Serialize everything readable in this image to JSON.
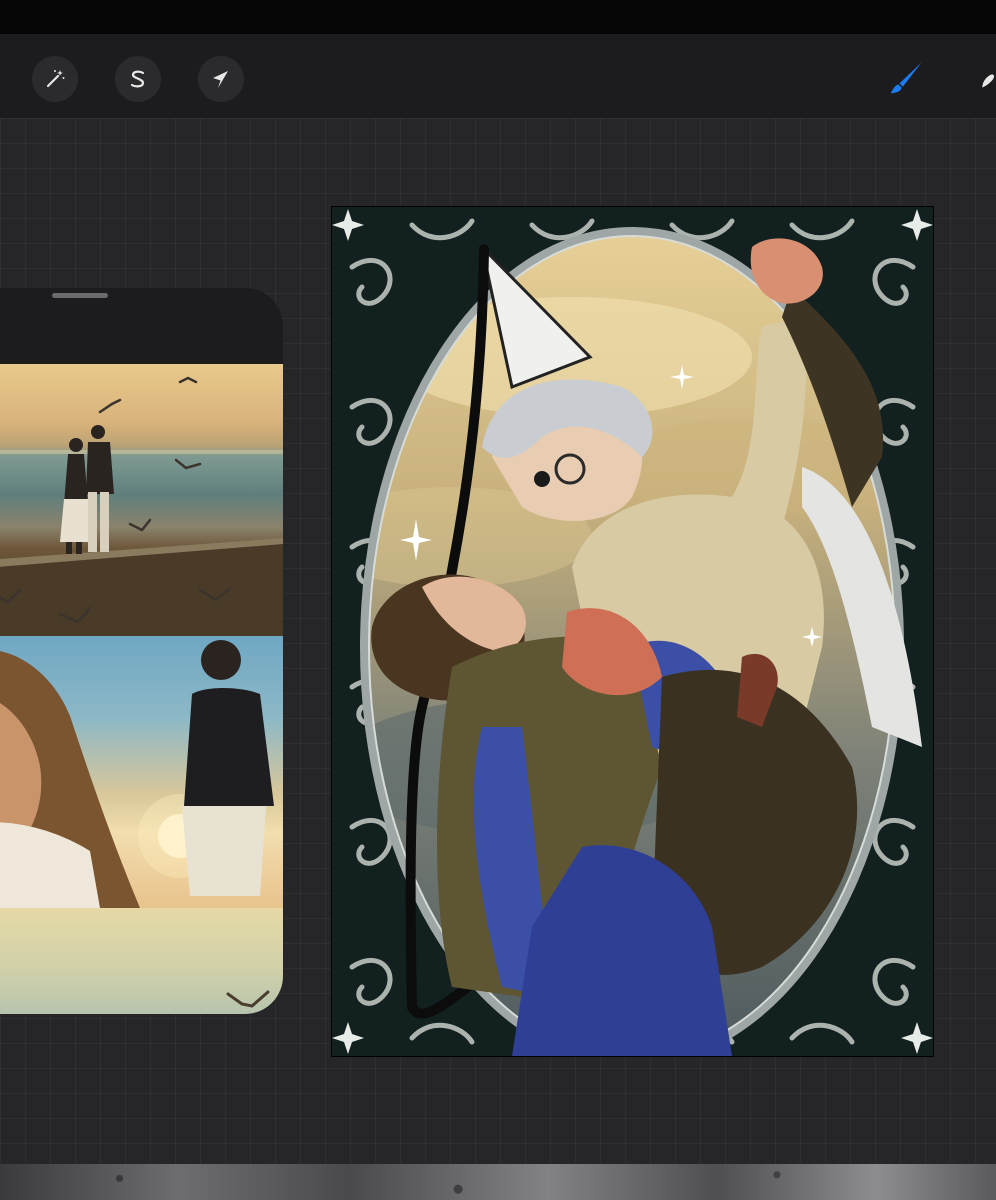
{
  "toolbar": {
    "left_tools": [
      {
        "name": "adjustments",
        "icon": "magic-wand-icon"
      },
      {
        "name": "selection",
        "icon": "selection-s-icon"
      },
      {
        "name": "transform",
        "icon": "arrow-cursor-icon"
      }
    ],
    "right_tools": [
      {
        "name": "brush",
        "icon": "paintbrush-icon",
        "active": true
      },
      {
        "name": "smudge",
        "icon": "smudge-icon"
      }
    ]
  },
  "colors": {
    "toolbar_bg": "#1c1c1e",
    "canvas_bg": "#262628",
    "accent": "#1a7cf2",
    "icon": "#e8e8e8"
  }
}
